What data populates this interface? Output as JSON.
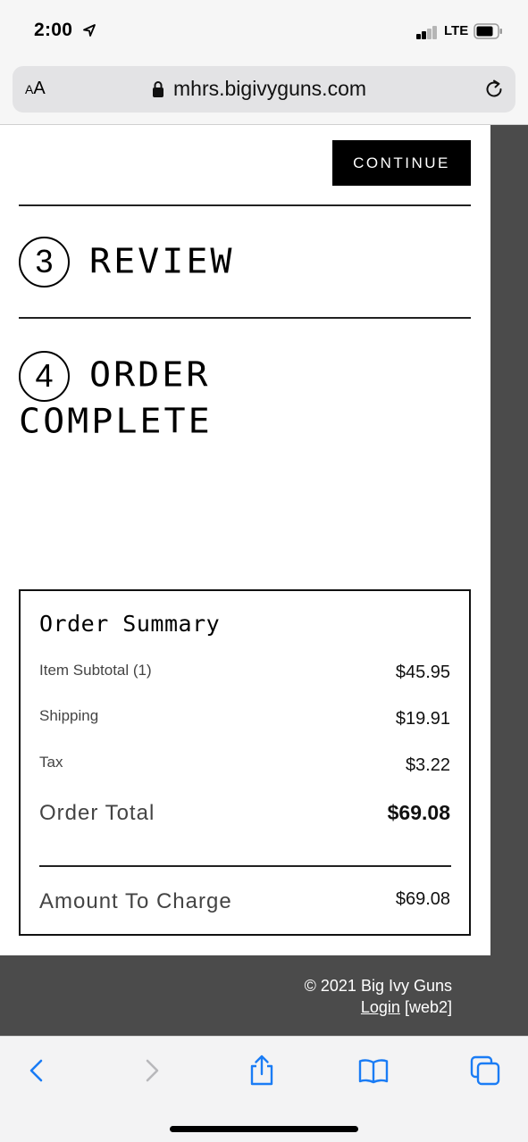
{
  "status_bar": {
    "time": "2:00",
    "network": "LTE"
  },
  "browser": {
    "text_size_label_small": "A",
    "text_size_label_large": "A",
    "url": "mhrs.bigivyguns.com"
  },
  "checkout": {
    "continue_label": "CONTINUE",
    "steps": [
      {
        "number": "3",
        "title": "REVIEW"
      },
      {
        "number": "4",
        "title": "ORDER",
        "title_line2": "COMPLETE"
      }
    ]
  },
  "order_summary": {
    "title": "Order Summary",
    "rows": [
      {
        "label": "Item Subtotal (1)",
        "value": "$45.95"
      },
      {
        "label": "Shipping",
        "value": "$19.91"
      },
      {
        "label": "Tax",
        "value": "$3.22"
      }
    ],
    "total_label": "Order Total",
    "total_value": "$69.08",
    "charge_label": "Amount To Charge",
    "charge_value": "$69.08"
  },
  "footer": {
    "copyright": "© 2021 Big Ivy Guns",
    "login_link": "Login",
    "build_tag": "[web2]"
  },
  "toolbar": {
    "icons": [
      "back-icon",
      "forward-icon",
      "share-icon",
      "bookmarks-icon",
      "tabs-icon"
    ],
    "accent_color": "#1a7cf5",
    "disabled_color": "#b8b8bb"
  }
}
